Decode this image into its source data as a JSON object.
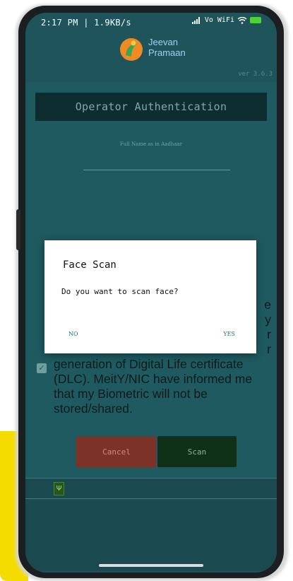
{
  "status_bar": {
    "time": "2:17 PM",
    "separator": "|",
    "data_speed": "1.9KB/s",
    "signal_text": "Vo WiFi"
  },
  "header": {
    "logo_line1": "Jeevan",
    "logo_line2": "Pramaan",
    "version": "ver 3.6.3"
  },
  "screen": {
    "title": "Operator Authentication",
    "name_label": "Full Name as in Aadhaar",
    "consent_lines": [
      "e",
      "y",
      "r",
      "r",
      "generation of Digital Life certificate",
      "(DLC). MeitY/NIC have informed me",
      "that my Biometric will not be",
      "stored/shared."
    ],
    "consent_checked": true,
    "cancel_label": "Cancel",
    "scan_label": "Scan"
  },
  "dialog": {
    "title": "Face Scan",
    "message": "Do you want to scan face?",
    "no_label": "NO",
    "yes_label": "YES"
  },
  "colors": {
    "screen_bg": "#1e545a",
    "banner_bg": "#0e2d30",
    "cancel_bg": "#7d3228",
    "scan_bg": "#0e3117",
    "dialog_accent": "#167a6f",
    "battery": "#4cd137"
  },
  "icons": {
    "battery": "battery-charging-icon",
    "wifi": "wifi-icon",
    "signal": "signal-bars-icon",
    "usb": "usb-icon",
    "check": "checkbox-checked-icon"
  }
}
